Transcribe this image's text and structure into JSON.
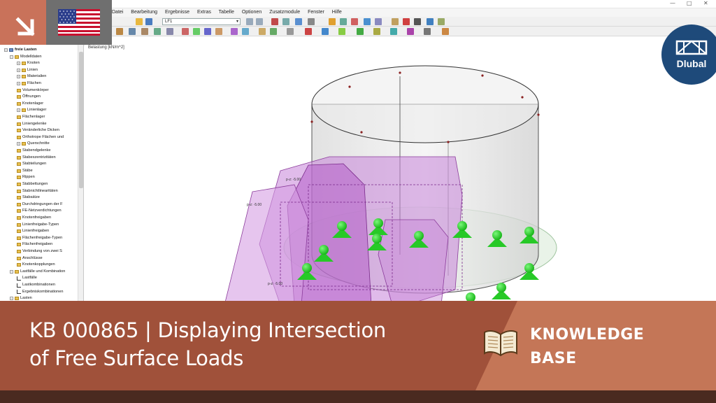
{
  "app": {
    "menu": [
      "Datei",
      "Bearbeitung",
      "Ergebnisse",
      "Extras",
      "Tabelle",
      "Optionen",
      "Zusatzmodule",
      "Fenster",
      "Hilfe"
    ],
    "loadcase_selector": "LF1",
    "window_controls": [
      "—",
      "□",
      "✕"
    ]
  },
  "navigator": {
    "items": [
      {
        "label": "freie Lasten",
        "level": 0,
        "type": "root"
      },
      {
        "label": "Modelldaten",
        "level": 1,
        "type": "folder"
      },
      {
        "label": "Knoten",
        "level": 2,
        "type": "folder"
      },
      {
        "label": "Linien",
        "level": 2,
        "type": "folder"
      },
      {
        "label": "Materialien",
        "level": 2,
        "type": "folder"
      },
      {
        "label": "Flächen",
        "level": 2,
        "type": "folder"
      },
      {
        "label": "Volumenkörper",
        "level": 2,
        "type": "folder"
      },
      {
        "label": "Öffnungen",
        "level": 2,
        "type": "folder"
      },
      {
        "label": "Knotenlager",
        "level": 2,
        "type": "folder"
      },
      {
        "label": "Linienlager",
        "level": 2,
        "type": "folder"
      },
      {
        "label": "Flächenlager",
        "level": 2,
        "type": "folder"
      },
      {
        "label": "Liniengelenke",
        "level": 2,
        "type": "folder"
      },
      {
        "label": "Veränderliche Dicken",
        "level": 2,
        "type": "folder"
      },
      {
        "label": "Orthotrope Flächen und",
        "level": 2,
        "type": "folder"
      },
      {
        "label": "Querschnitte",
        "level": 2,
        "type": "folder"
      },
      {
        "label": "Stabendgelenke",
        "level": 2,
        "type": "folder"
      },
      {
        "label": "Stabexzentrizitäten",
        "level": 2,
        "type": "folder"
      },
      {
        "label": "Stabteilungen",
        "level": 2,
        "type": "folder"
      },
      {
        "label": "Stäbe",
        "level": 2,
        "type": "folder"
      },
      {
        "label": "Rippen",
        "level": 2,
        "type": "folder"
      },
      {
        "label": "Stabbettungen",
        "level": 2,
        "type": "folder"
      },
      {
        "label": "Stabnichtlinearitäten",
        "level": 2,
        "type": "folder"
      },
      {
        "label": "Stabsätze",
        "level": 2,
        "type": "folder"
      },
      {
        "label": "Durchdringungen der F",
        "level": 2,
        "type": "folder"
      },
      {
        "label": "FE-Netzverdichtungen",
        "level": 2,
        "type": "folder"
      },
      {
        "label": "Knotenfreigaben",
        "level": 2,
        "type": "folder"
      },
      {
        "label": "Linienfreigabe-Typen",
        "level": 2,
        "type": "folder"
      },
      {
        "label": "Linienfreigaben",
        "level": 2,
        "type": "folder"
      },
      {
        "label": "Flächenfreigabe-Typen",
        "level": 2,
        "type": "folder"
      },
      {
        "label": "Flächenfreigaben",
        "level": 2,
        "type": "folder"
      },
      {
        "label": "Verbindung von zwei S",
        "level": 2,
        "type": "folder"
      },
      {
        "label": "Anschlüsse",
        "level": 2,
        "type": "folder"
      },
      {
        "label": "Knotenkopplungen",
        "level": 2,
        "type": "folder"
      },
      {
        "label": "Lastfälle und Kombination",
        "level": 1,
        "type": "folder"
      },
      {
        "label": "Lastfälle",
        "level": 2,
        "type": "leaf"
      },
      {
        "label": "Lastkombinationen",
        "level": 2,
        "type": "leaf"
      },
      {
        "label": "Ergebniskombinationen",
        "level": 2,
        "type": "leaf"
      },
      {
        "label": "Lasten",
        "level": 1,
        "type": "folder"
      }
    ]
  },
  "viewport": {
    "title": "Belastung [kN/m^2]",
    "load_labels": [
      "p-z: -5.00",
      "p-z: -5.00",
      "p-z: -5.00"
    ]
  },
  "overlay": {
    "headline_line1": "KB 000865 | Displaying Intersection",
    "headline_line2": "of Free Surface Loads",
    "kb_line1": "KNOWLEDGE",
    "kb_line2": "BASE",
    "logo_text": "Dlubal",
    "corner_icon": "arrow-down-right-icon",
    "flag_icon": "us-flag-icon"
  },
  "colors": {
    "banner": "#a0513a",
    "banner_accent": "#c47657",
    "corner": "#c9725a",
    "logo": "#1e4a7a",
    "load_purple": "#b070c8",
    "support_green": "#22cc22"
  }
}
